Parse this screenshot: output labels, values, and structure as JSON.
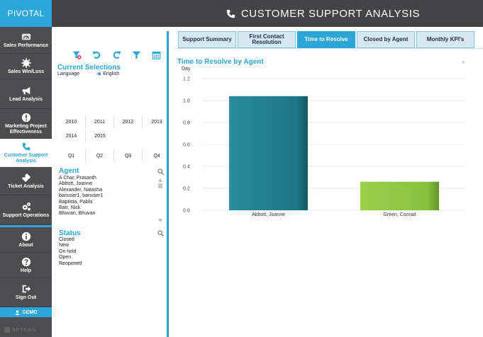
{
  "header": {
    "brand": "PIVOTAL",
    "title": "CUSTOMER SUPPORT ANALYSIS",
    "title_icon": "phone-icon"
  },
  "nav": {
    "items": [
      {
        "label": "Sales Performance",
        "icon": "dashboard-gauge-icon"
      },
      {
        "label": "Sales Win/Loss",
        "icon": "gear-burst-icon"
      },
      {
        "label": "Lead Analysis",
        "icon": "megaphone-icon"
      },
      {
        "label": "Marketing Project Effectiveness",
        "icon": "exclamation-circle-icon"
      },
      {
        "label": "Customer Support Analysis",
        "icon": "phone-icon",
        "active": true
      },
      {
        "label": "Ticket Analysis",
        "icon": "ticket-icon"
      },
      {
        "label": "Support Operations",
        "icon": "cogs-icon"
      },
      {
        "label": "About",
        "icon": "info-circle-icon"
      },
      {
        "label": "Help",
        "icon": "question-circle-icon"
      },
      {
        "label": "Sign Out",
        "icon": "sign-out-icon"
      }
    ],
    "demo_label": "DEMO",
    "footer_logo": "APTEAN"
  },
  "selections": {
    "title": "Current Selections",
    "field": "Language",
    "value": "English",
    "tool_icons": [
      "clear-filter-icon",
      "undo-icon",
      "redo-icon",
      "filter-icon",
      "calendar-icon"
    ]
  },
  "years": [
    [
      "2010",
      "2011",
      "2012",
      "2013"
    ],
    [
      "2014",
      "2015"
    ]
  ],
  "quarters": [
    "Q1",
    "Q2",
    "Q3",
    "Q4"
  ],
  "agent": {
    "title": "Agent",
    "items": [
      "A Char, Prasanth",
      "Abbott, Joanne",
      "Alexander, Natasha",
      "banuser1, banuser1",
      "Baptista, Pablo",
      "Barr, Nick",
      "Bhuvan, Bhuvan"
    ]
  },
  "status": {
    "title": "Status",
    "items": [
      "Closed",
      "New",
      "On hold",
      "Open",
      "Reopened"
    ]
  },
  "tabs": [
    {
      "label": "Support Summary"
    },
    {
      "label": "First Contact Resolution"
    },
    {
      "label": "Time to Resolve",
      "active": true
    },
    {
      "label": "Closed by Agent"
    },
    {
      "label": "Monthly KPI's"
    }
  ],
  "chart": {
    "title": "Time to Resolve by Agent",
    "more": "»",
    "colors": {
      "bar1": "#1e7a8a",
      "bar2": "#8cc63f",
      "accent": "#2aa6d9"
    }
  },
  "chart_data": {
    "type": "bar",
    "categories": [
      "Abbott, Joanne",
      "Green, Conrad"
    ],
    "values": [
      1.04,
      0.26
    ],
    "ylabel": "Day",
    "ylim": [
      0,
      1.2
    ],
    "yticks": [
      "0.0",
      "0.2",
      "0.4",
      "0.6",
      "0.8",
      "1.0",
      "1.2"
    ],
    "grid": true
  }
}
